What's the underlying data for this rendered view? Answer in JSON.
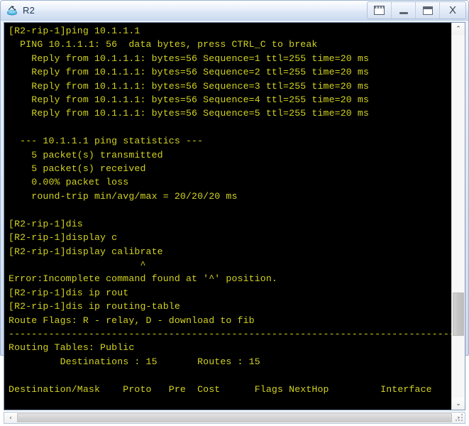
{
  "window": {
    "title": "R2",
    "app_icon": "router-icon",
    "buttons": [
      {
        "name": "restore-button",
        "icon": "restore-window-icon",
        "label": ""
      },
      {
        "name": "minimize-button",
        "icon": "minimize-icon",
        "label": ""
      },
      {
        "name": "maximize-button",
        "icon": "maximize-icon",
        "label": ""
      },
      {
        "name": "close-button",
        "icon": "close-icon",
        "label": "X"
      }
    ]
  },
  "terminal": {
    "foreground_color": "#d2d222",
    "background_color": "#000000",
    "lines": [
      "[R2-rip-1]ping 10.1.1.1",
      "  PING 10.1.1.1: 56  data bytes, press CTRL_C to break",
      "    Reply from 10.1.1.1: bytes=56 Sequence=1 ttl=255 time=20 ms",
      "    Reply from 10.1.1.1: bytes=56 Sequence=2 ttl=255 time=20 ms",
      "    Reply from 10.1.1.1: bytes=56 Sequence=3 ttl=255 time=20 ms",
      "    Reply from 10.1.1.1: bytes=56 Sequence=4 ttl=255 time=20 ms",
      "    Reply from 10.1.1.1: bytes=56 Sequence=5 ttl=255 time=20 ms",
      "",
      "  --- 10.1.1.1 ping statistics ---",
      "    5 packet(s) transmitted",
      "    5 packet(s) received",
      "    0.00% packet loss",
      "    round-trip min/avg/max = 20/20/20 ms",
      "",
      "[R2-rip-1]dis",
      "[R2-rip-1]display c",
      "[R2-rip-1]display calibrate",
      "                       ^",
      "Error:Incomplete command found at '^' position.",
      "[R2-rip-1]dis ip rout",
      "[R2-rip-1]dis ip routing-table",
      "Route Flags: R - relay, D - download to fib",
      "------------------------------------------------------------------------------",
      "Routing Tables: Public",
      "         Destinations : 15       Routes : 15",
      "",
      "Destination/Mask    Proto   Pre  Cost      Flags NextHop         Interface",
      ""
    ]
  },
  "scrollbars": {
    "vertical": {
      "up_arrow": "⌃",
      "down_arrow": "⌄",
      "thumb_top_pct": 71,
      "thumb_height_pct": 12
    },
    "horizontal": {
      "left_arrow": "‹",
      "right_arrow": "›"
    }
  }
}
